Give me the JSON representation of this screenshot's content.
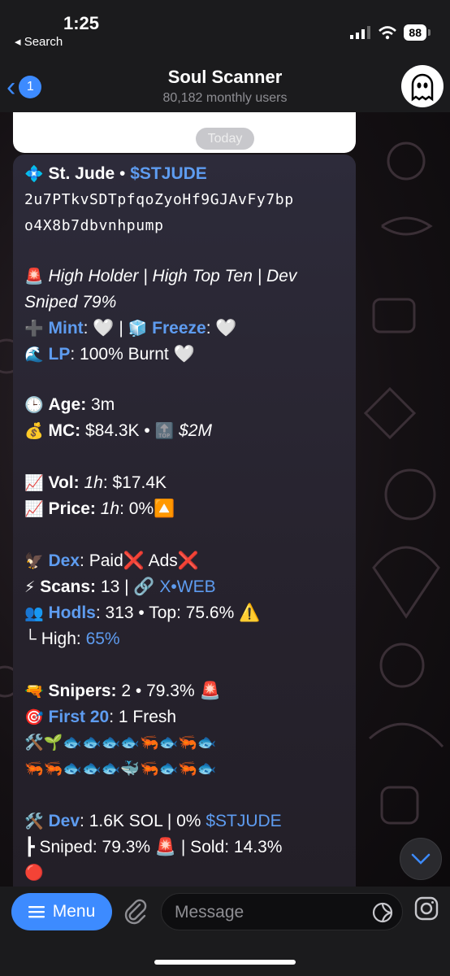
{
  "status_bar": {
    "time": "1:25",
    "back_app": "◂ Search",
    "battery": "88"
  },
  "header": {
    "back_count": "1",
    "title": "Soul Scanner",
    "subtitle": "80,182 monthly users",
    "avatar_icon": "ghost-icon"
  },
  "date_separator": "Today",
  "message": {
    "token_icon": "💠",
    "token_name": "St. Jude",
    "dot": "•",
    "ticker": "$STJUDE",
    "address_line1": "2u7PTkvSDTpfqoZyoHf9GJAvFy7bp",
    "address_line2": "o4X8b7dbvnhpump",
    "alert_icon": "🚨",
    "risk_line1": "High Holder | High Top Ten | Dev",
    "risk_line2": "Sniped 79%",
    "mint_icon": "➕",
    "mint_label": "Mint",
    "mint_value": ": 🤍 | ",
    "freeze_icon": "🧊",
    "freeze_label": "Freeze",
    "freeze_value": ": 🤍",
    "lp_icon": "🌊",
    "lp_label": "LP",
    "lp_value": ": 100% Burnt 🤍",
    "age_icon": "🕒",
    "age_label": "Age:",
    "age_value": " 3m",
    "mc_icon": "💰",
    "mc_label": "MC:",
    "mc_value": " $84.3K • ",
    "top_icon": "🔝",
    "mc_top": "$2M",
    "vol_icon": "📈",
    "vol_label": "Vol:",
    "vol_period": " 1h",
    "vol_value": ": $17.4K",
    "price_icon": "📈",
    "price_label": "Price:",
    "price_period": " 1h",
    "price_value": ": 0%🔼",
    "dex_icon": "🦅",
    "dex_label": "Dex",
    "dex_value": ": Paid❌ Ads❌",
    "scans_icon": "⚡",
    "scans_label": "Scans:",
    "scans_value": " 13 | 🔗 ",
    "scans_x": "X",
    "scans_sep": "•",
    "scans_web": "WEB",
    "hodls_icon": "👥",
    "hodls_label": "Hodls",
    "hodls_value": ": 313 • Top: 75.6% ⚠️",
    "high_prefix": "└ High: ",
    "high_value": "65%",
    "snipers_icon": "🔫",
    "snipers_label": "Snipers:",
    "snipers_value": " 2 • 79.3% 🚨",
    "first_icon": "🎯",
    "first_label": "First 20",
    "first_value": ": 1 Fresh",
    "holders_row1": "🛠️🌱🐟🐟🐟🐟🦐🐟🦐🐟",
    "holders_row2": "🦐🦐🐟🐟🐟🐳🦐🐟🦐🐟",
    "dev_icon": "🛠️",
    "dev_label": "Dev",
    "dev_value": ": 1.6K SOL | 0% ",
    "dev_ticker": "$STJUDE",
    "dev_line2": "┣ Sniped: 79.3% 🚨 | Sold: 14.3%",
    "dev_line3": "🔴"
  },
  "input_bar": {
    "menu_label": "Menu",
    "placeholder": "Message"
  },
  "colors": {
    "accent": "#3d8bff",
    "link": "#5e9cf0",
    "bubble": "#2b2936"
  }
}
